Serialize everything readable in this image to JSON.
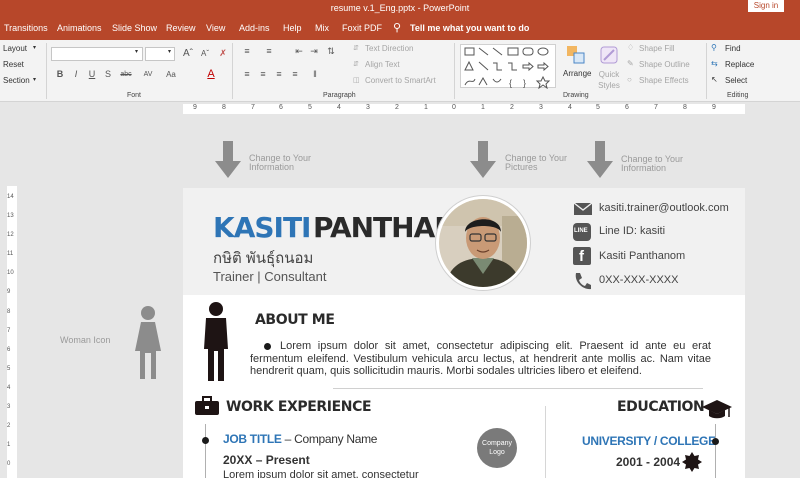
{
  "window": {
    "title": "resume v.1_Eng.pptx  -  PowerPoint",
    "signin": "Sign in"
  },
  "tabs": [
    "Transitions",
    "Animations",
    "Slide Show",
    "Review",
    "View",
    "Add-ins",
    "Help",
    "Mix",
    "Foxit PDF"
  ],
  "tellme": "Tell me what you want to do",
  "ribbon": {
    "slides_group": [
      "Layout",
      "Reset",
      "Section"
    ],
    "font_label": "Font",
    "paragraph_label": "Paragraph",
    "drawing_label": "Drawing",
    "editing_label": "Editing",
    "paragraph_cmds": [
      "Text Direction",
      "Align Text",
      "Convert to SmartArt"
    ],
    "arrange": "Arrange",
    "quick_styles": "Quick Styles",
    "shape_cmds": [
      "Shape Fill",
      "Shape Outline",
      "Shape Effects"
    ],
    "editing_cmds": [
      "Find",
      "Replace",
      "Select"
    ],
    "font_buttons": [
      "B",
      "I",
      "U",
      "S",
      "abc",
      "AV",
      "Aa",
      "A"
    ]
  },
  "ruler_numbers": [
    "9",
    "8",
    "7",
    "6",
    "5",
    "4",
    "3",
    "2",
    "1",
    "0",
    "1",
    "2",
    "3",
    "4",
    "5",
    "6",
    "7",
    "8",
    "9"
  ],
  "vruler_numbers": [
    "14",
    "13",
    "12",
    "11",
    "10",
    "9",
    "8",
    "7",
    "6",
    "5",
    "4",
    "3",
    "2",
    "1",
    "0"
  ],
  "hints": {
    "info1": "Change to Your Information",
    "pictures": "Change to Your Pictures",
    "info2": "Change to Your Information",
    "woman": "Woman Icon"
  },
  "resume": {
    "first_name": "KASITI",
    "last_name": "PANTHANOM",
    "thai_name": "กษิติ พันธุ์ถนอม",
    "role": "Trainer | Consultant",
    "email": "kasiti.trainer@outlook.com",
    "line": "Line ID: kasiti",
    "facebook": "Kasiti Panthanom",
    "phone": "0XX-XXX-XXXX",
    "line_logo": "LINE",
    "about_title": "ABOUT ME",
    "about_text": "Lorem ipsum dolor sit amet, consectetur adipiscing elit. Praesent id ante eu erat fermentum eleifend. Vestibulum vehicula arcu lectus, at hendrerit ante mollis ac. Nam vitae hendrerit quam, quis sollicitudin mauris. Morbi sodales ultricies libero et eleifend.",
    "work_title": "WORK EXPERIENCE",
    "job_title": "JOB TITLE",
    "company": " – Company Name",
    "job_years": "20XX – Present",
    "company_logo": "Company Logo",
    "work_text": "Lorem ipsum dolor sit amet, consectetur",
    "education_title": "EDUCATION",
    "university": "UNIVERSITY / COLLEGE",
    "edu_years": "2001 - 2004"
  },
  "colors": {
    "accent": "#b7472a",
    "name_blue": "#2e75b6",
    "dark": "#2a2a2a"
  }
}
